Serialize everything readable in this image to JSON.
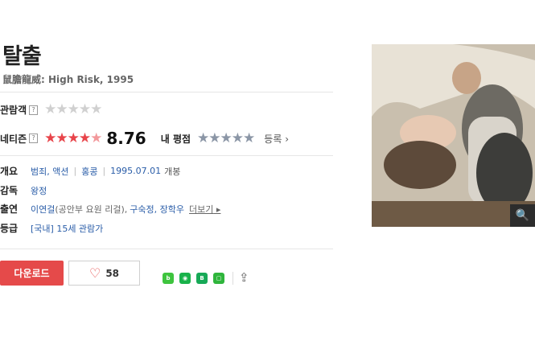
{
  "movie": {
    "title": "탈출",
    "subtitle": "鼠膽龍威: High Risk, 1995"
  },
  "ratings": {
    "audience_label": "관람객",
    "audience_stars": 0,
    "netizen_label": "네티즌",
    "netizen_score": "8.76",
    "netizen_stars": 4.4,
    "my_rating_label": "내 평점",
    "register_label": "등록"
  },
  "info": {
    "overview_label": "개요",
    "genres": "범죄, 액션",
    "country": "홍콩",
    "release": "1995.07.01",
    "release_suffix": "개봉",
    "director_label": "감독",
    "director": "왕정",
    "cast_label": "출연",
    "cast_primary": "이연걸",
    "cast_primary_role": "(공안부 요원 리걸),",
    "cast_others": "구숙정, 장학우",
    "more_label": "더보기",
    "grade_label": "등급",
    "grade": "[국내] 15세 관람가"
  },
  "actions": {
    "download_label": "다운로드",
    "like_count": "58"
  },
  "colors": {
    "accent": "#e54a4a",
    "link": "#2a5da8"
  }
}
